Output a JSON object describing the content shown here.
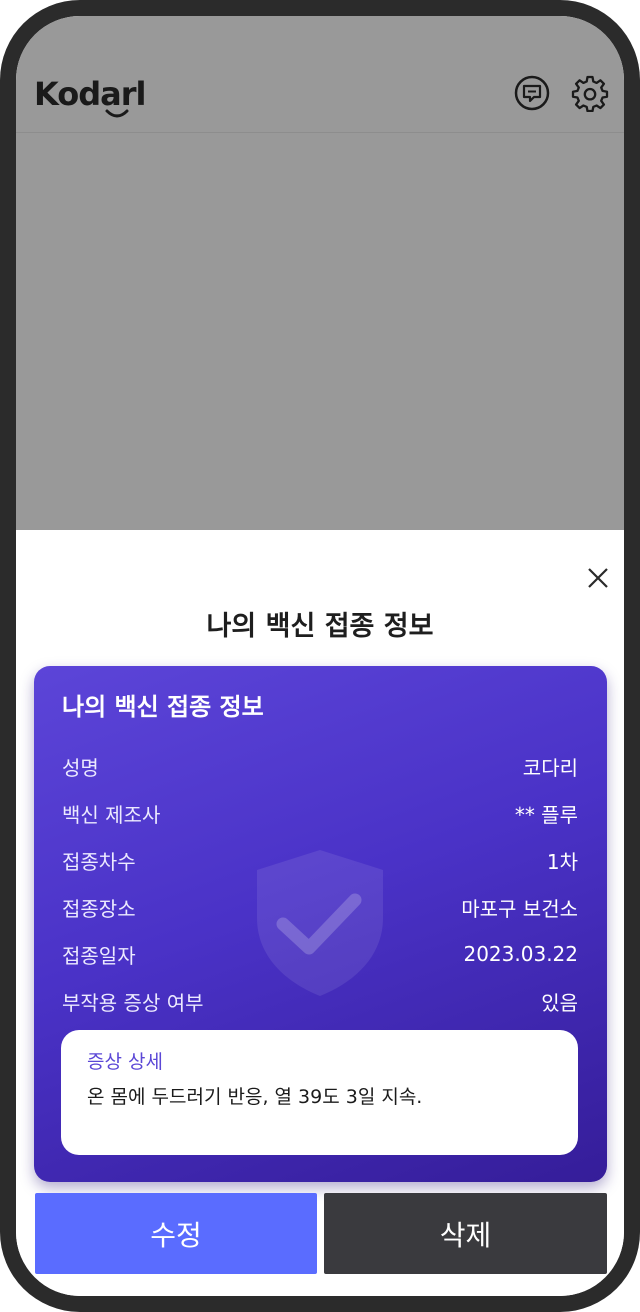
{
  "header": {
    "logo_text": "Kodarl",
    "icons": [
      "chat-icon",
      "gear-icon"
    ]
  },
  "sheet": {
    "title": "나의 백신 접종 정보",
    "close_icon": "close-icon"
  },
  "card": {
    "title": "나의 백신 접종 정보",
    "rows": [
      {
        "label": "성명",
        "value": "코다리"
      },
      {
        "label": "백신 제조사",
        "value": "** 플루"
      },
      {
        "label": "접종차수",
        "value": "1차"
      },
      {
        "label": "접종장소",
        "value": "마포구 보건소"
      },
      {
        "label": "접종일자",
        "value": "2023.03.22"
      },
      {
        "label": "부작용 증상 여부",
        "value": "있음"
      }
    ],
    "detail": {
      "title": "증상 상세",
      "text": "온 몸에 두드러기 반응, 열 39도 3일 지속."
    }
  },
  "buttons": {
    "edit_label": "수정",
    "delete_label": "삭제"
  },
  "colors": {
    "card_gradient_start": "#5c45d8",
    "card_gradient_end": "#351d99",
    "edit_button": "#5a6cff",
    "delete_button": "#3a3a3e",
    "overlay": "#999999"
  }
}
